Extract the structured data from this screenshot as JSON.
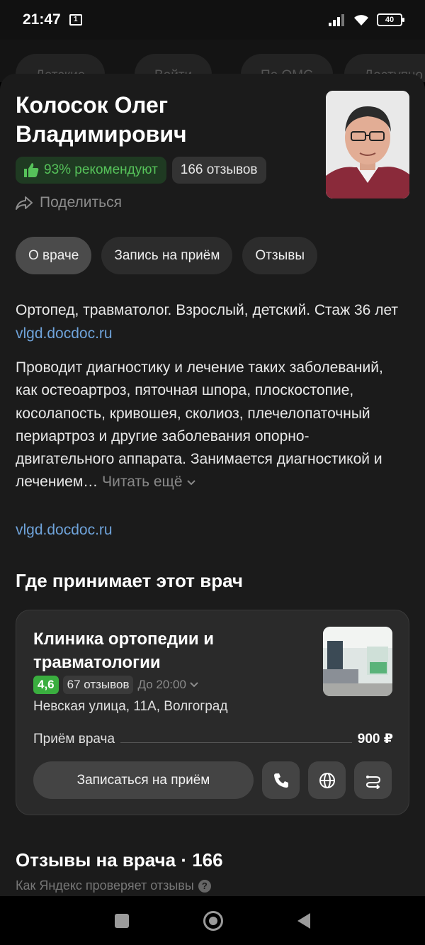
{
  "status_bar": {
    "time": "21:47",
    "sim_label": "1",
    "battery": "40"
  },
  "background_chips": [
    "Детские",
    "Войти",
    "По ОМС",
    "Доступно"
  ],
  "doctor": {
    "name": "Колосок Олег Владимирович",
    "recommend": "93% рекомендуют",
    "reviews": "166 отзывов",
    "share_label": "Поделиться"
  },
  "tabs": [
    {
      "label": "О враче",
      "active": true
    },
    {
      "label": "Запись на приём",
      "active": false
    },
    {
      "label": "Отзывы",
      "active": false
    }
  ],
  "about": {
    "text": "Ортопед, травматолог. Взрослый, детский. Стаж 36 лет",
    "source": "vlgd.docdoc.ru",
    "description": "Проводит диагностику и лечение таких заболеваний, как остеоартроз, пяточная шпора, плоскостопие, косолапость, кривошея, сколиоз, плечелопаточный периартроз и другие заболевания опорно-двигательного аппарата. Занимается диагностикой и лечением…",
    "read_more": "Читать ещё",
    "description_source": "vlgd.docdoc.ru"
  },
  "where_title": "Где принимает этот врач",
  "clinic": {
    "name": "Клиника ортопедии и травматологии",
    "rating": "4,6",
    "reviews": "67 отзывов",
    "hours": "До 20:00",
    "address": "Невская улица, 11А, Волгоград",
    "service": "Приём врача",
    "price": "900 ₽",
    "book_label": "Записаться на приём"
  },
  "reviews_section": {
    "title": "Отзывы на врача · 166",
    "verify_label": "Как Яндекс проверяет отзывы",
    "help_glyph": "?"
  }
}
